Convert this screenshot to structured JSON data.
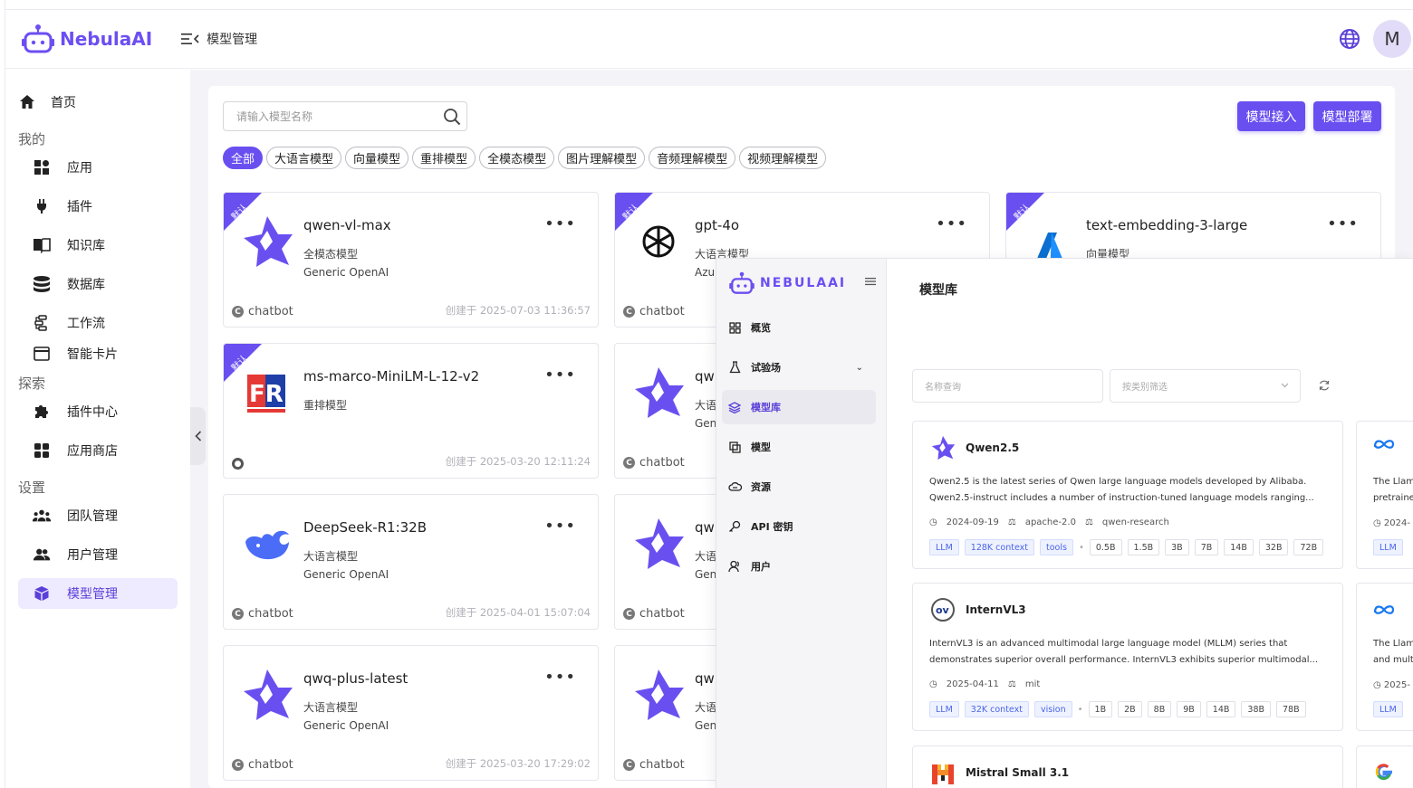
{
  "header": {
    "brand": "NebulaAI",
    "section": "模型管理",
    "avatar_initial": "M",
    "accent": "#6a4ff0"
  },
  "sidebar": {
    "home": "首页",
    "group_mine": "我的",
    "group_explore": "探索",
    "group_settings": "设置",
    "items": {
      "apps": "应用",
      "plugins": "插件",
      "knowledge": "知识库",
      "database": "数据库",
      "workflow": "工作流",
      "cards": "智能卡片",
      "plugin_center": "插件中心",
      "app_store": "应用商店",
      "team": "团队管理",
      "users": "用户管理",
      "models": "模型管理"
    }
  },
  "toolbar": {
    "search_placeholder": "请输入模型名称",
    "btn_connect": "模型接入",
    "btn_deploy": "模型部署"
  },
  "filters": [
    "全部",
    "大语言模型",
    "向量模型",
    "重排模型",
    "全模态模型",
    "图片理解模型",
    "音频理解模型",
    "视频理解模型"
  ],
  "ribbon_label": "默认",
  "cards": [
    {
      "title": "qwen-vl-max",
      "type": "全模态模型",
      "provider": "Generic OpenAI",
      "tag": "chatbot",
      "date": "创建于 2025-07-03 11:36:57"
    },
    {
      "title": "gpt-4o",
      "type": "大语言模型",
      "provider": "Azu",
      "tag": "chatbot",
      "date": ""
    },
    {
      "title": "text-embedding-3-large",
      "type": "向量模型",
      "provider": "",
      "tag": "",
      "date": ""
    },
    {
      "title": "ms-marco-MiniLM-L-12-v2",
      "type": "重排模型",
      "provider": "",
      "tag": "",
      "date": "创建于 2025-03-20 12:11:24"
    },
    {
      "title": "qw",
      "type": "大语",
      "provider": "Gen",
      "tag": "chatbot",
      "date": ""
    },
    {
      "title": "DeepSeek-R1:32B",
      "type": "大语言模型",
      "provider": "Generic OpenAI",
      "tag": "chatbot",
      "date": "创建于 2025-04-01 15:07:04"
    },
    {
      "title": "qw",
      "type": "大语",
      "provider": "Gen",
      "tag": "chatbot",
      "date": ""
    },
    {
      "title": "qwq-plus-latest",
      "type": "大语言模型",
      "provider": "Generic OpenAI",
      "tag": "chatbot",
      "date": "创建于 2025-03-20 17:29:02"
    },
    {
      "title": "qw",
      "type": "大语",
      "provider": "Gen",
      "tag": "chatbot",
      "date": ""
    }
  ],
  "overlay": {
    "brand": "NEBULAAI",
    "menu": {
      "overview": "概览",
      "playground": "试验场",
      "model_library": "模型库",
      "models": "模型",
      "resources": "资源",
      "api_keys": "API 密钥",
      "users": "用户"
    },
    "title": "模型库",
    "name_placeholder": "名称查询",
    "category_placeholder": "按类别筛选",
    "library": [
      {
        "name": "Qwen2.5",
        "desc1": "Qwen2.5 is the latest series of Qwen large language models developed by Alibaba.",
        "desc2": "Qwen2.5-instruct includes a number of instruction-tuned language models ranging...",
        "date": "2024-09-19",
        "license": "apache-2.0",
        "org": "qwen-research",
        "tags": [
          "LLM",
          "128K context",
          "tools"
        ],
        "sizes": [
          "0.5B",
          "1.5B",
          "3B",
          "7B",
          "14B",
          "32B",
          "72B"
        ]
      },
      {
        "name": "InternVL3",
        "desc1": "InternVL3 is an advanced multimodal large language model (MLLM) series that",
        "desc2": "demonstrates superior overall performance. InternVL3 exhibits superior multimodal...",
        "date": "2025-04-11",
        "license": "mit",
        "org": "",
        "tags": [
          "LLM",
          "32K context",
          "vision"
        ],
        "sizes": [
          "1B",
          "2B",
          "8B",
          "9B",
          "14B",
          "38B",
          "78B"
        ]
      },
      {
        "name": "Mistral Small 3.1"
      }
    ],
    "partial": [
      {
        "line1": "The Llam",
        "line2": "pretraine",
        "date": "2024-",
        "tag": "LLM"
      },
      {
        "line1": "The Llam",
        "line2": "and mult",
        "date": "2025-",
        "tag": "LLM"
      }
    ]
  }
}
